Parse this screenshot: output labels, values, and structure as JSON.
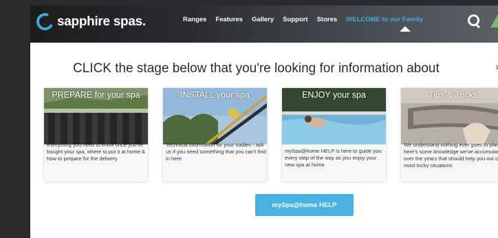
{
  "header": {
    "brand": "sapphire spas.",
    "nav": [
      "Ranges",
      "Features",
      "Gallery",
      "Support",
      "Stores"
    ],
    "welcome": "WELCOME to our Family"
  },
  "headline": "CLICK the stage below that you're looking for information about",
  "cards": [
    {
      "title": "PREPARE for your spa",
      "desc": "Everything you need to know once you've bought your spa, where to put it at home & how to prepare for the delivery"
    },
    {
      "title": "INSTALL your spa",
      "desc": "Technical information for your tradies - ask us if you need something that you can't find in here"
    },
    {
      "title": "ENJOY your spa",
      "desc": "mySpa@home HELP is here to guide you every step of the way as you enjoy your new spa at home"
    },
    {
      "title": "Tips & Tricks",
      "desc": "We understand nothing ever goes to plan so here's some knowledge we've accumulated over the years that should help you out of most tricky situations"
    }
  ],
  "help_button": "mySpa@home HELP",
  "colors": {
    "accent": "#4ab2e3",
    "welcome": "#45b3e6",
    "logo_mark": "#3aa9dd"
  }
}
